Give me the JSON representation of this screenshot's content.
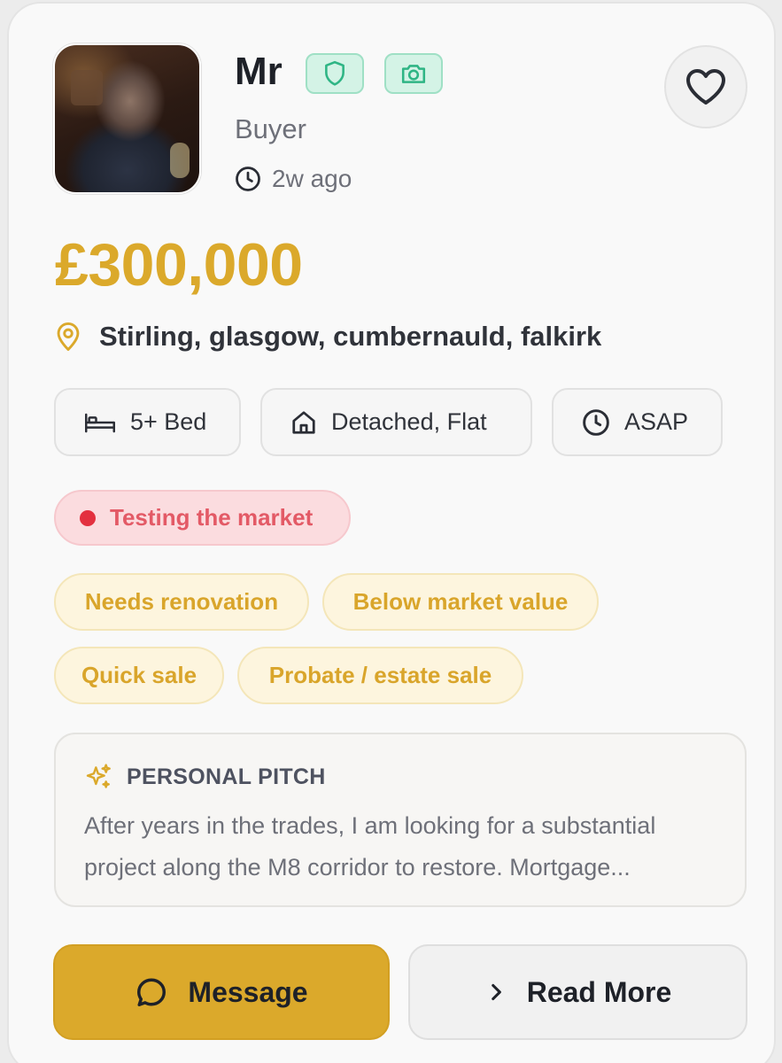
{
  "profile": {
    "name": "Mr",
    "role": "Buyer",
    "posted": "2w ago",
    "badges": [
      "shield-icon",
      "camera-icon"
    ]
  },
  "listing": {
    "price": "£300,000",
    "location": "Stirling, glasgow, cumbernauld, falkirk",
    "chips": {
      "bedrooms": "5+ Bed",
      "property_type": "Detached, Flat",
      "timeline": "ASAP"
    },
    "status": "Testing the market",
    "tags": [
      "Needs renovation",
      "Below market value",
      "Quick sale",
      "Probate / estate sale"
    ]
  },
  "pitch": {
    "heading": "PERSONAL PITCH",
    "text": "After years in the trades, I am looking for a substantial project along the M8 corridor to restore. Mortgage..."
  },
  "actions": {
    "message": "Message",
    "read_more": "Read More"
  },
  "colors": {
    "accent": "#dba92b",
    "status_red": "#e3303f",
    "badge_green": "#2fb585"
  }
}
